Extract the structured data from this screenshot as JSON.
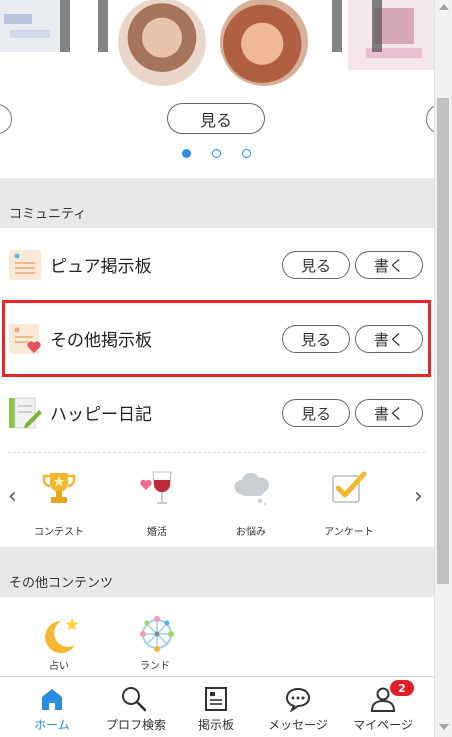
{
  "carousel": {
    "see_label": "見る",
    "dots": [
      "active",
      "inactive",
      "inactive"
    ],
    "accent": "#2a8de1"
  },
  "community": {
    "heading": "コミュニティ",
    "rows": [
      {
        "label": "ピュア掲示板",
        "see": "見る",
        "write": "書く"
      },
      {
        "label": "その他掲示板",
        "see": "見る",
        "write": "書く"
      },
      {
        "label": "ハッピー日記",
        "see": "見る",
        "write": "書く"
      }
    ],
    "highlight_color": "#e8262a"
  },
  "quick_menu": {
    "items": [
      {
        "label": "コンテスト",
        "icon": "trophy-icon"
      },
      {
        "label": "婚活",
        "icon": "wine-glass-icon"
      },
      {
        "label": "お悩み",
        "icon": "worry-cloud-icon"
      },
      {
        "label": "アンケート",
        "icon": "checkbox-icon"
      }
    ]
  },
  "other_contents": {
    "heading": "その他コンテンツ",
    "items": [
      {
        "label": "占い",
        "icon": "moon-star-icon"
      },
      {
        "label": "ランド",
        "icon": "ferris-wheel-icon"
      }
    ]
  },
  "bottom_nav": {
    "items": [
      {
        "label": "ホーム",
        "icon": "home-icon",
        "active": true
      },
      {
        "label": "プロフ検索",
        "icon": "search-icon"
      },
      {
        "label": "掲示板",
        "icon": "board-icon"
      },
      {
        "label": "メッセージ",
        "icon": "chat-icon"
      },
      {
        "label": "マイページ",
        "icon": "person-icon"
      }
    ],
    "mypage_badge": "2"
  }
}
